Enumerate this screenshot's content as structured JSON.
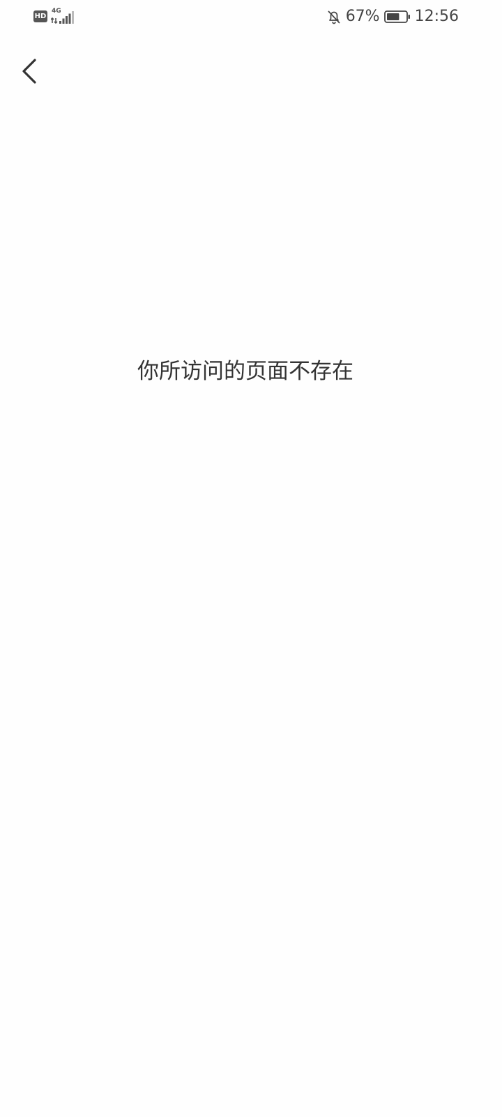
{
  "status_bar": {
    "hd_label": "HD",
    "network_label": "4G",
    "signal_bars_filled": 4,
    "signal_bars_total": 5,
    "notification_icon": "bell-off-icon",
    "battery_percent_text": "67%",
    "battery_level": 0.67,
    "time": "12:56"
  },
  "nav": {
    "back_icon": "chevron-left-icon"
  },
  "main": {
    "message": "你所访问的页面不存在"
  },
  "colors": {
    "background": "#fefefe",
    "text": "#333333",
    "status_text": "#444444"
  }
}
